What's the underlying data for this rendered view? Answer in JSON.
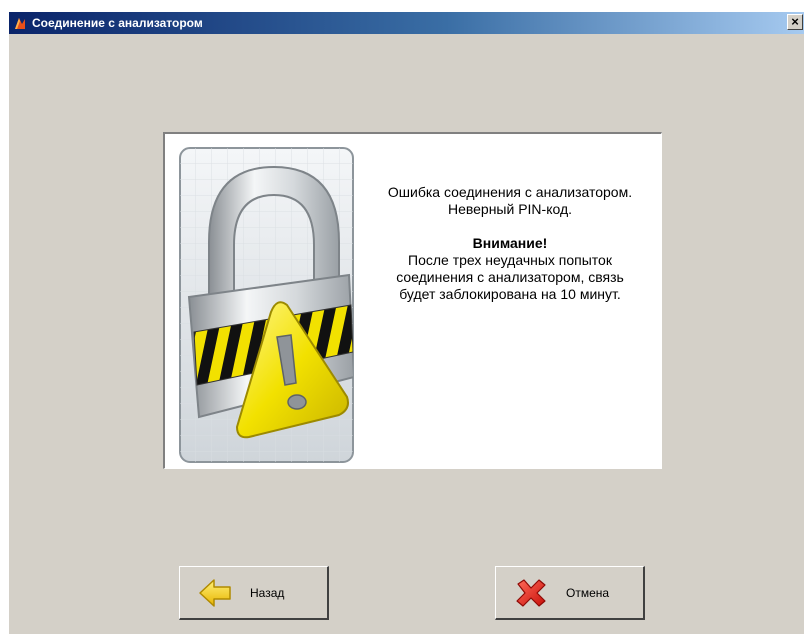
{
  "window": {
    "title": "Соединение с анализатором",
    "close_glyph": "×",
    "icons": {
      "app": "app-logo-icon",
      "close": "close-icon"
    }
  },
  "message": {
    "line1": "Ошибка соединения с анализатором.",
    "line2": "Неверный PIN-код.",
    "warning_title": "Внимание!",
    "warning_line1": "После трех неудачных попыток",
    "warning_line2": "соединения с анализатором, связь",
    "warning_line3": "будет заблокирована на 10 минут."
  },
  "buttons": {
    "back": {
      "label": "Назад",
      "icon": "arrow-left-icon"
    },
    "cancel": {
      "label": "Отмена",
      "icon": "red-x-icon"
    }
  },
  "colors": {
    "titlebar_start": "#0a246a",
    "titlebar_end": "#a6caf0",
    "dialog_bg": "#d4d0c8",
    "warning_yellow": "#f2e100"
  }
}
